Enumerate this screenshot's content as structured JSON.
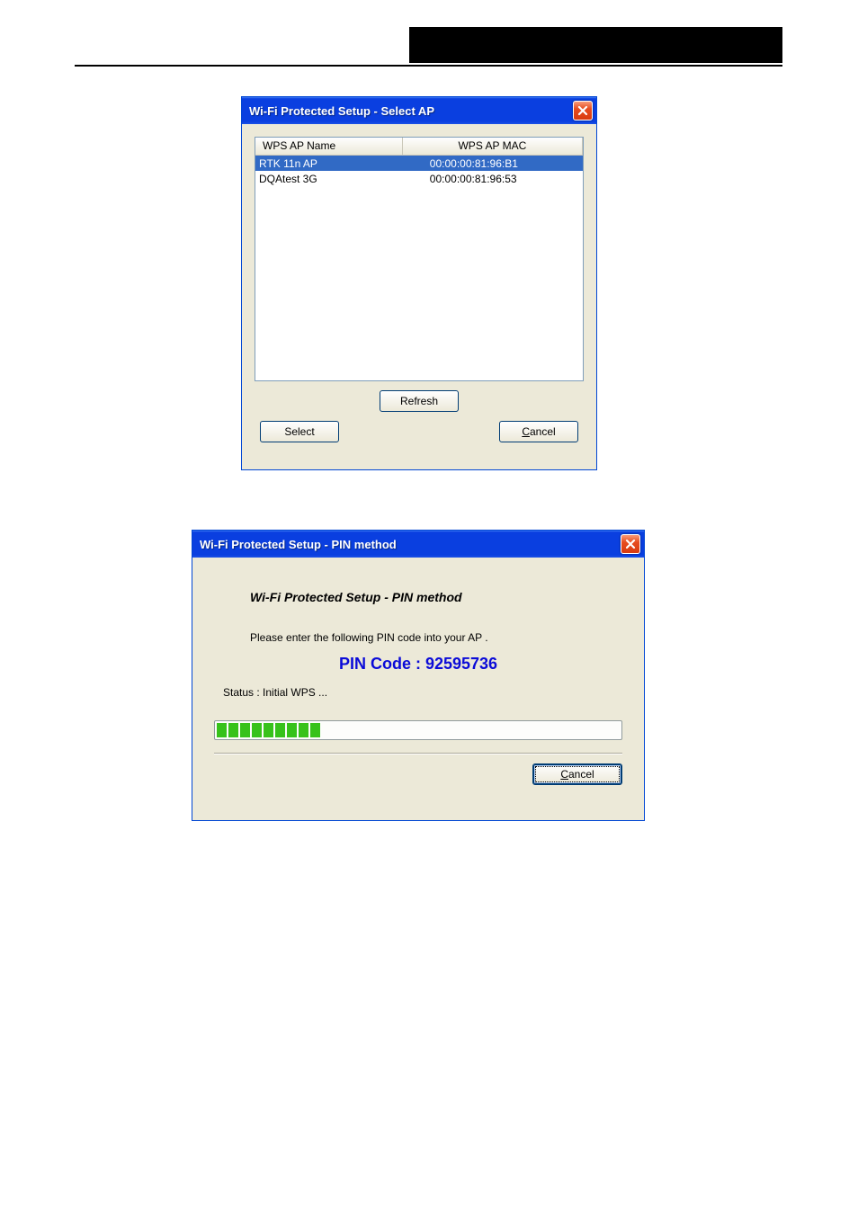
{
  "dialog1": {
    "title": "Wi-Fi Protected Setup - Select AP",
    "columns": {
      "name": "WPS AP Name",
      "mac": "WPS AP MAC"
    },
    "rows": [
      {
        "name": "RTK 11n AP",
        "mac": "00:00:00:81:96:B1",
        "selected": true
      },
      {
        "name": "DQAtest  3G",
        "mac": "00:00:00:81:96:53",
        "selected": false
      }
    ],
    "buttons": {
      "refresh": "Refresh",
      "select": "Select",
      "cancel_prefix": "C",
      "cancel_rest": "ancel"
    }
  },
  "dialog2": {
    "title": "Wi-Fi Protected Setup - PIN method",
    "heading": "Wi-Fi Protected Setup - PIN method",
    "instruction": "Please enter the following PIN code into your AP .",
    "pin_label": "PIN Code :  92595736",
    "status": "Status :  Initial WPS ...",
    "progress_blocks": 9,
    "buttons": {
      "cancel_prefix": "C",
      "cancel_rest": "ancel"
    }
  }
}
